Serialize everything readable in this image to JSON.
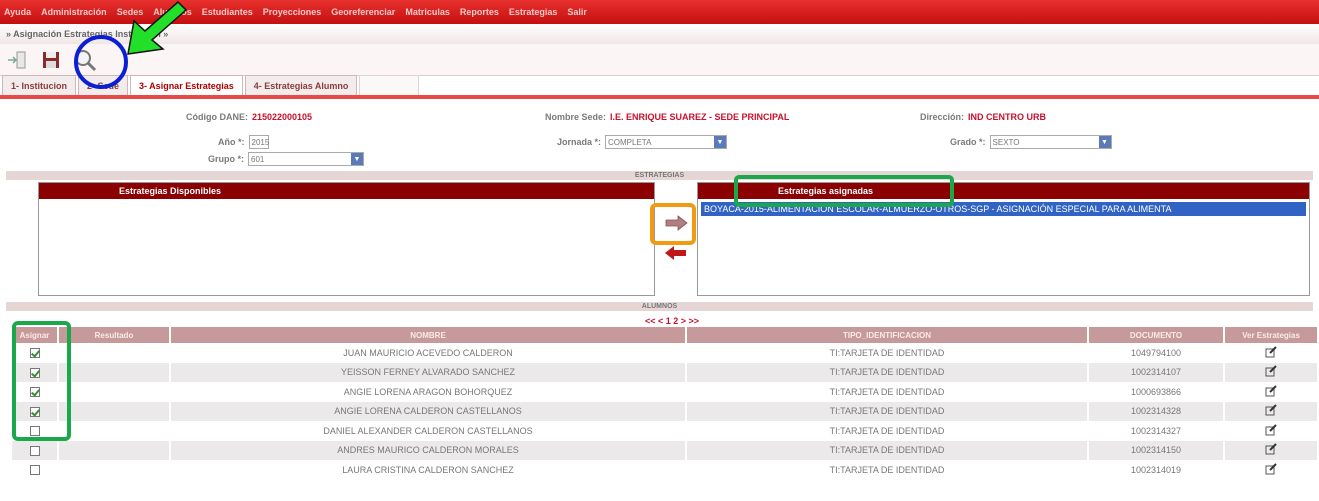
{
  "menu": {
    "items": [
      "Ayuda",
      "Administración",
      "Sedes",
      "Alumnos",
      "Estudiantes",
      "Proyecciones",
      "Georeferenciar",
      "Matriculas",
      "Reportes",
      "Estrategias",
      "Salir"
    ]
  },
  "breadcrumb": "» Asignación Estrategias Institución »",
  "tabs": [
    {
      "label": "1- Institucion"
    },
    {
      "label": "2- Sede"
    },
    {
      "label": "3- Asignar Estrategias"
    },
    {
      "label": "4- Estrategias Alumno"
    }
  ],
  "info": {
    "codigo_label": "Código DANE:",
    "codigo_value": "215022000105",
    "sede_label": "Nombre Sede:",
    "sede_value": "I.E. ENRIQUE SUAREZ - SEDE PRINCIPAL",
    "direccion_label": "Dirección:",
    "direccion_value": "IND CENTRO URB",
    "anio_label": "Año *:",
    "anio_value": "2015",
    "jornada_label": "Jornada *:",
    "jornada_value": "COMPLETA",
    "grado_label": "Grado *:",
    "grado_value": "SEXTO",
    "grupo_label": "Grupo *:",
    "grupo_value": "601"
  },
  "sections": {
    "estrategias": "ESTRATEGIAS",
    "alumnos": "ALUMNOS"
  },
  "boxes": {
    "disponibles_title": "Estrategias Disponibles",
    "asignadas_title": "Estrategias asignadas",
    "asignadas_items": [
      "BOYACA-2015-ALIMENTACION ESCOLAR-ALMUERZO-OTROS-SGP - ASIGNACIÓN ESPECIAL PARA ALIMENTA"
    ]
  },
  "pager": "<< < 1 2 > >>",
  "table": {
    "headers": [
      "Asignar",
      "Resultado",
      "NOMBRE",
      "TIPO_IDENTIFICACION",
      "DOCUMENTO",
      "Ver Estrategias"
    ],
    "rows": [
      {
        "checked": true,
        "nombre": "JUAN MAURICIO ACEVEDO CALDERON",
        "tipo": "TI:TARJETA DE IDENTIDAD",
        "documento": "1049794100"
      },
      {
        "checked": true,
        "nombre": "YEISSON FERNEY ALVARADO SANCHEZ",
        "tipo": "TI:TARJETA DE IDENTIDAD",
        "documento": "1002314107"
      },
      {
        "checked": true,
        "nombre": "ANGIE LORENA ARAGON BOHORQUEZ",
        "tipo": "TI:TARJETA DE IDENTIDAD",
        "documento": "1000693866"
      },
      {
        "checked": true,
        "nombre": "ANGIE LORENA CALDERON CASTELLANOS",
        "tipo": "TI:TARJETA DE IDENTIDAD",
        "documento": "1002314328"
      },
      {
        "checked": false,
        "nombre": "DANIEL ALEXANDER CALDERON CASTELLANOS",
        "tipo": "TI:TARJETA DE IDENTIDAD",
        "documento": "1002314327"
      },
      {
        "checked": false,
        "nombre": "ANDRES MAURICO CALDERON MORALES",
        "tipo": "TI:TARJETA DE IDENTIDAD",
        "documento": "1002314150"
      },
      {
        "checked": false,
        "nombre": "LAURA CRISTINA CALDERON SANCHEZ",
        "tipo": "TI:TARJETA DE IDENTIDAD",
        "documento": "1002314019"
      }
    ]
  },
  "colors": {
    "menu_red": "#d8201f",
    "dark_red": "#8b0000",
    "annotation_blue": "#0a1fd6",
    "annotation_green": "#1aa84a",
    "annotation_orange": "#f39a12",
    "arrow_green": "#22e02a"
  }
}
